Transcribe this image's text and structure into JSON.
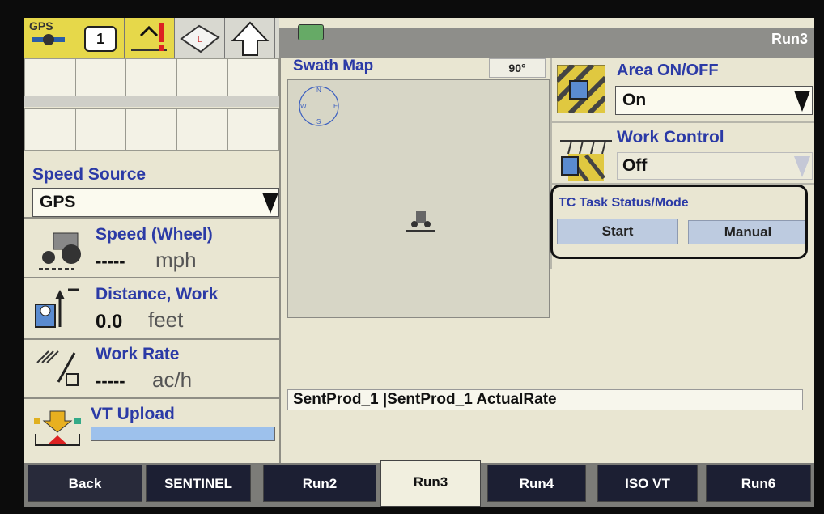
{
  "iconbar": {
    "gps_label": "GPS",
    "counter_label": "1"
  },
  "header": {
    "run_title": "Run3"
  },
  "left": {
    "speed_source": {
      "title": "Speed Source",
      "value": "GPS"
    },
    "speed": {
      "title": "Speed (Wheel)",
      "value": "-----",
      "unit": "mph"
    },
    "distance": {
      "title": "Distance, Work",
      "value": "0.0",
      "unit": "feet"
    },
    "work_rate": {
      "title": "Work Rate",
      "value": "-----",
      "unit": "ac/h"
    },
    "vt_upload": {
      "title": "VT Upload"
    }
  },
  "swath": {
    "title": "Swath Map",
    "heading": "90°",
    "compass": {
      "n": "N",
      "s": "S",
      "e": "E",
      "w": "W"
    }
  },
  "right": {
    "area": {
      "title": "Area ON/OFF",
      "value": "On"
    },
    "work_control": {
      "title": "Work Control",
      "value": "Off"
    },
    "tc_task": {
      "title": "TC Task Status/Mode",
      "start": "Start",
      "manual": "Manual"
    }
  },
  "product_line": "SentProd_1 |SentProd_1 ActualRate",
  "tabs": [
    {
      "label": "Back"
    },
    {
      "label": "SENTINEL"
    },
    {
      "label": "Run2"
    },
    {
      "label": "Run3"
    },
    {
      "label": "Run4"
    },
    {
      "label": "ISO VT"
    },
    {
      "label": "Run6"
    }
  ],
  "colors": {
    "accent_blue": "#2b3aa6",
    "screen_bg": "#e9e6d2",
    "tab_dark": "#1c1f33",
    "button_blue": "#bdcbe0"
  }
}
